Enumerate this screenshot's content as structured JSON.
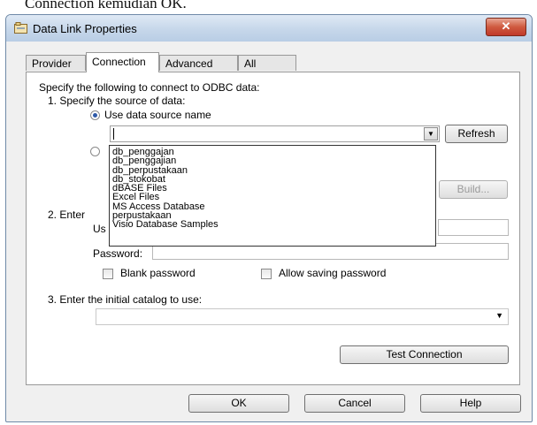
{
  "caption": "Connection kemudian OK.",
  "window": {
    "title": "Data Link Properties",
    "close_glyph": "✕"
  },
  "tabs": [
    {
      "label": "Provider"
    },
    {
      "label": "Connection"
    },
    {
      "label": "Advanced"
    },
    {
      "label": "All"
    }
  ],
  "connection": {
    "intro": "Specify the following to connect to ODBC data:",
    "step1": "1. Specify the source of data:",
    "use_dsn_label": "Use data source name",
    "dsn_value": "",
    "refresh_label": "Refresh",
    "build_label": "Build...",
    "step2": "2. Enter",
    "user_prefix": "Us",
    "password_label": "Password:",
    "blank_password_label": "Blank password",
    "allow_saving_label": "Allow saving password",
    "step3": "3. Enter the initial catalog to use:",
    "catalog_value": "",
    "test_connection_label": "Test Connection"
  },
  "dsn_options": [
    "db_penggajan",
    "db_penggajian",
    "db_perpustakaan",
    "db_stokobat",
    "dBASE Files",
    "Excel Files",
    "MS Access Database",
    "perpustakaan",
    "Visio Database Samples"
  ],
  "footer": {
    "ok_label": "OK",
    "cancel_label": "Cancel",
    "help_label": "Help"
  }
}
